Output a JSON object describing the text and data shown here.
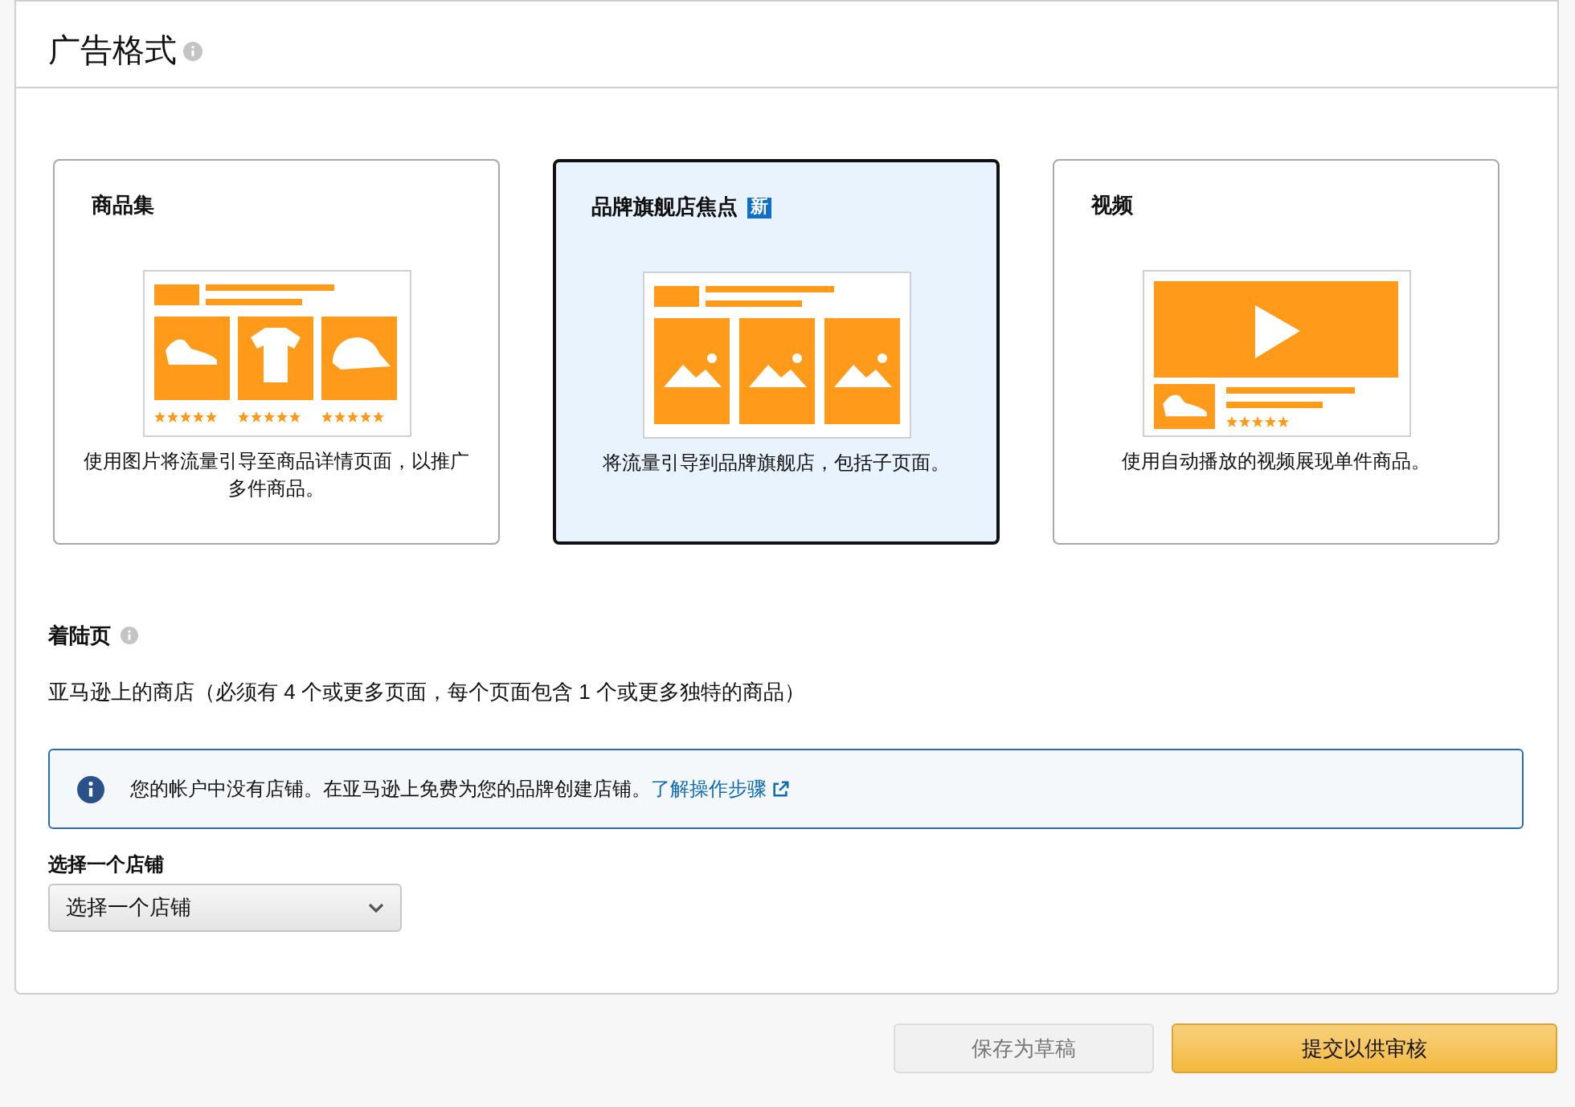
{
  "section_title": "广告格式",
  "formats": [
    {
      "kind": "products",
      "title": "商品集",
      "description": "使用图片将流量引导至商品详情页面，以推广多件商品。",
      "selected": false
    },
    {
      "kind": "brand",
      "title": "品牌旗舰店焦点",
      "badge": "新",
      "description": "将流量引导到品牌旗舰店，包括子页面。",
      "selected": true
    },
    {
      "kind": "video",
      "title": "视频",
      "description": "使用自动播放的视频展现单件商品。",
      "selected": false
    }
  ],
  "landing_page": {
    "label": "着陆页",
    "value": "亚马逊上的商店（必须有 4 个或更多页面，每个页面包含 1 个或更多独特的商品）"
  },
  "notice": {
    "text": "您的帐户中没有店铺。在亚马逊上免费为您的品牌创建店铺。",
    "link": "了解操作步骤"
  },
  "store_select": {
    "label": "选择一个店铺",
    "value": "选择一个店铺"
  },
  "buttons": [
    {
      "kind": "secondary",
      "label": "保存为草稿",
      "disabled": true
    },
    {
      "kind": "primary",
      "label": "提交以供审核",
      "disabled": false
    }
  ]
}
